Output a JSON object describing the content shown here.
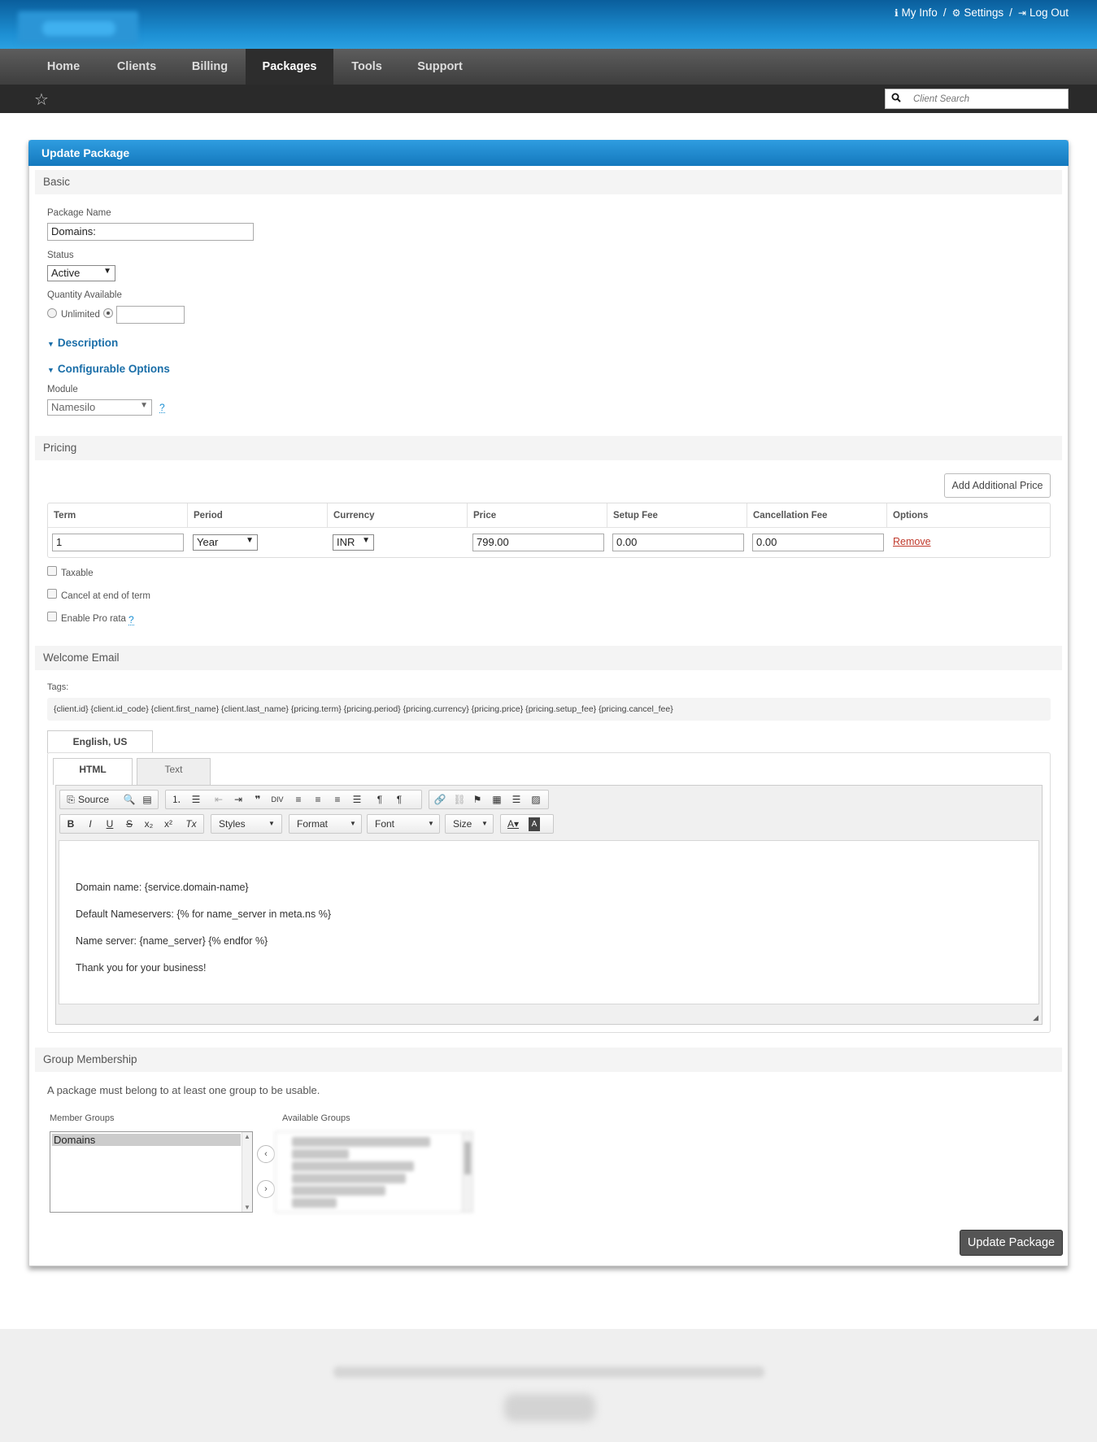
{
  "header": {
    "links": [
      {
        "icon": "info-icon",
        "label": "My Info"
      },
      {
        "icon": "gear-icon",
        "label": "Settings"
      },
      {
        "icon": "logout-icon",
        "label": "Log Out"
      }
    ],
    "separator": "/"
  },
  "nav": {
    "items": [
      "Home",
      "Clients",
      "Billing",
      "Packages",
      "Tools",
      "Support"
    ],
    "active": "Packages"
  },
  "search": {
    "placeholder": "Client Search"
  },
  "panel": {
    "title": "Update Package"
  },
  "basic": {
    "section_title": "Basic",
    "package_name_label": "Package Name",
    "package_name_value": "Domains:",
    "status_label": "Status",
    "status_value": "Active",
    "quantity_label": "Quantity Available",
    "unlimited_label": "Unlimited",
    "quantity_value": "",
    "description_toggle": "Description",
    "config_toggle": "Configurable Options",
    "module_label": "Module",
    "module_value": "Namesilo",
    "help": "?"
  },
  "pricing": {
    "section_title": "Pricing",
    "add_button": "Add Additional Price",
    "columns": [
      "Term",
      "Period",
      "Currency",
      "Price",
      "Setup Fee",
      "Cancellation Fee",
      "Options"
    ],
    "row": {
      "term": "1",
      "period": "Year",
      "currency": "INR",
      "price": "799.00",
      "setup_fee": "0.00",
      "cancel_fee": "0.00",
      "option": "Remove"
    },
    "taxable_label": "Taxable",
    "cancel_end_label": "Cancel at end of term",
    "prorata_label": "Enable Pro rata"
  },
  "welcome": {
    "section_title": "Welcome Email",
    "tags_label": "Tags:",
    "tags": "{client.id} {client.id_code} {client.first_name} {client.last_name} {pricing.term} {pricing.period} {pricing.currency} {pricing.price} {pricing.setup_fee} {pricing.cancel_fee}",
    "lang_tab": "English, US",
    "html_tab": "HTML",
    "text_tab": "Text",
    "toolbar": {
      "source": "Source",
      "styles": "Styles",
      "format": "Format",
      "font": "Font",
      "size": "Size"
    },
    "body_lines": [
      "Domain name: {service.domain-name}",
      "Default Nameservers: {% for name_server in meta.ns %}",
      "Name server: {name_server} {% endfor %}",
      "Thank you for your business!"
    ]
  },
  "groups": {
    "section_title": "Group Membership",
    "note": "A package must belong to at least one group to be usable.",
    "member_label": "Member Groups",
    "member_items": [
      "Domains"
    ],
    "available_label": "Available Groups"
  },
  "submit": {
    "label": "Update Package"
  }
}
